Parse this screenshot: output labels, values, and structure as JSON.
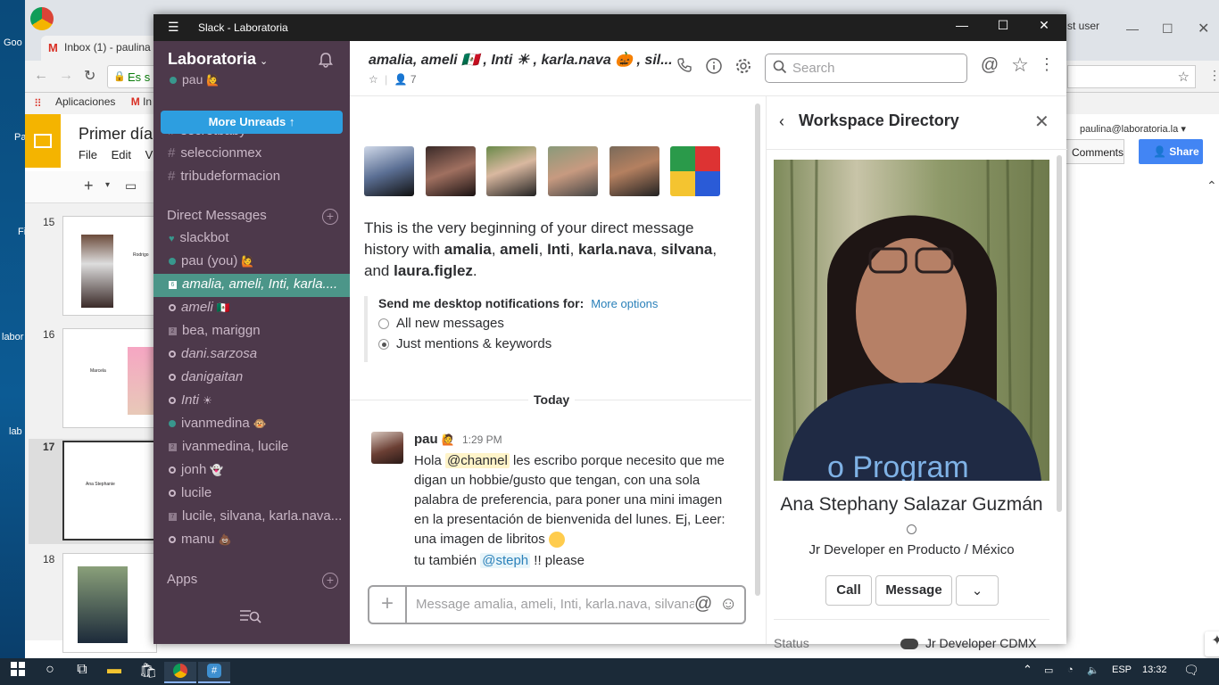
{
  "desktop": {
    "labels": [
      "Goo",
      "Pa",
      "Fi",
      "labor",
      "lab"
    ]
  },
  "chrome": {
    "tab_title": "Inbox (1) - paulina",
    "address_text": "Es s",
    "bookmarks": [
      "Aplicaciones",
      "In"
    ],
    "other_window_text": "st user"
  },
  "docs": {
    "title": "Primer día",
    "menu": [
      "File",
      "Edit",
      "V"
    ],
    "email": "paulina@laboratoria.la",
    "comments_label": "Comments",
    "share_label": "Share",
    "slides": [
      {
        "num": "15",
        "caption_name": "Rodrigo"
      },
      {
        "num": "16",
        "caption_name": "Marcela"
      },
      {
        "num": "17",
        "caption_name": "Ana Stephanie"
      },
      {
        "num": "18",
        "caption_name": ""
      }
    ]
  },
  "slack": {
    "window_title": "Slack - Laboratoria",
    "workspace": "Laboratoria",
    "current_user": "pau",
    "more_unreads": "More Unreads",
    "partial_channel": "secretbaby",
    "channels": [
      "seleccionmex",
      "tribudeformacion"
    ],
    "direct_messages_label": "Direct Messages",
    "apps_label": "Apps",
    "dms": [
      {
        "label": "slackbot",
        "kind": "heart",
        "active": false,
        "italic": false,
        "emoji": ""
      },
      {
        "label": "pau  (you)",
        "kind": "green",
        "active": false,
        "italic": false,
        "emoji": "🙋"
      },
      {
        "label": "amalia, ameli, Inti, karla....",
        "kind": "num",
        "num": "6",
        "active": true,
        "italic": true,
        "emoji": ""
      },
      {
        "label": "ameli",
        "kind": "hollow",
        "active": false,
        "italic": true,
        "emoji": "🇲🇽"
      },
      {
        "label": "bea, mariggn",
        "kind": "num",
        "num": "2",
        "active": false,
        "italic": false,
        "emoji": ""
      },
      {
        "label": "dani.sarzosa",
        "kind": "hollow",
        "active": false,
        "italic": true,
        "emoji": ""
      },
      {
        "label": "danigaitan",
        "kind": "hollow",
        "active": false,
        "italic": true,
        "emoji": ""
      },
      {
        "label": "Inti",
        "kind": "hollow",
        "active": false,
        "italic": true,
        "emoji": "☀"
      },
      {
        "label": "ivanmedina",
        "kind": "green",
        "active": false,
        "italic": false,
        "emoji": "🐵"
      },
      {
        "label": "ivanmedina, lucile",
        "kind": "num",
        "num": "2",
        "active": false,
        "italic": false,
        "emoji": ""
      },
      {
        "label": "jonh",
        "kind": "hollow",
        "active": false,
        "italic": false,
        "emoji": "👻"
      },
      {
        "label": "lucile",
        "kind": "hollow",
        "active": false,
        "italic": false,
        "emoji": ""
      },
      {
        "label": "lucile, silvana, karla.nava...",
        "kind": "num",
        "num": "7",
        "active": false,
        "italic": false,
        "emoji": ""
      },
      {
        "label": "manu",
        "kind": "hollow",
        "active": false,
        "italic": false,
        "emoji": "💩"
      }
    ],
    "header": {
      "title": "amalia, ameli 🇲🇽 , Inti ☀ , karla.nava 🎃 , sil...",
      "members": "7",
      "search_placeholder": "Search"
    },
    "intro": {
      "prefix": "This is the very beginning of your direct message history with ",
      "names": [
        "amalia",
        "ameli",
        "Inti",
        "karla.nava",
        "silvana",
        "laura.figlez"
      ]
    },
    "notifications": {
      "label": "Send me desktop notifications for:",
      "more_options": "More options",
      "options": [
        "All new messages",
        "Just mentions & keywords"
      ],
      "selected": 1
    },
    "day_divider": "Today",
    "message": {
      "author": "pau",
      "author_emoji": "🙋",
      "time": "1:29 PM",
      "text_before": "Hola ",
      "mention": "@channel",
      "text_after": " les escribo porque necesito que me digan un hobbie/gusto que tengan, con una sola palabra de preferencia, para poner una mini imagen en la presentación de bienvenida del lunes. Ej, Leer: una imagen de libritos ",
      "second_before": "tu también ",
      "second_mention": "@steph",
      "second_after": " !! please"
    },
    "composer_placeholder": "Message amalia, ameli, Inti, karla.nava, silvana...",
    "directory": {
      "title": "Workspace Directory",
      "name": "Ana Stephany Salazar Guzmán",
      "role": "Jr Developer en Producto / México",
      "call_label": "Call",
      "message_label": "Message",
      "status_label": "Status",
      "status_value": "Jr Developer CDMX",
      "shirt_text": "o Program"
    }
  },
  "taskbar": {
    "lang": "ESP",
    "time": "13:32"
  },
  "colors": {
    "sidebar": "#4d394b",
    "active_dm": "#4c9689",
    "more_unreads": "#2d9ee0",
    "link": "#2a80b9"
  }
}
